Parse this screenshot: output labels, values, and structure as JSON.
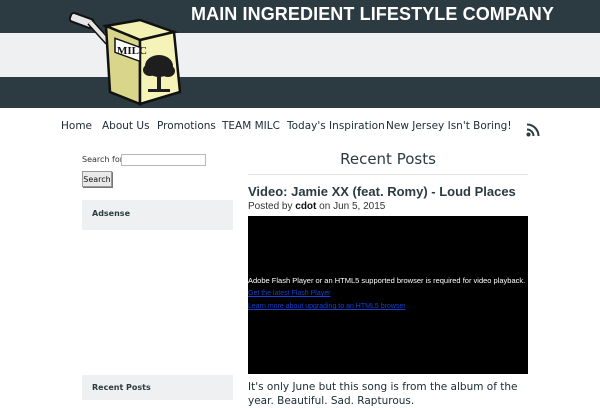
{
  "header": {
    "site_title": "MAIN INGREDIENT LIFESTYLE COMPANY",
    "logo_text": "MILC",
    "colors": {
      "dark_band": "#2b3b41",
      "light_band": "#eef0f2"
    }
  },
  "nav": {
    "items": [
      {
        "label": "Home"
      },
      {
        "label": "About Us"
      },
      {
        "label": "Promotions"
      },
      {
        "label": "TEAM MILC"
      },
      {
        "label": "Today's Inspiration"
      },
      {
        "label": "New Jersey Isn't Boring!"
      }
    ],
    "rss_icon": "rss-icon"
  },
  "sidebar": {
    "search": {
      "label": "Search for:",
      "value": "",
      "placeholder": "",
      "button_label": "Search"
    },
    "widgets": [
      {
        "title": "Adsense"
      },
      {
        "title": "Recent Posts"
      }
    ]
  },
  "main": {
    "section_title": "Recent Posts",
    "post": {
      "title": "Video: Jamie XX (feat. Romy) - Loud Places",
      "meta_prefix": "Posted by",
      "author": "cdot",
      "meta_mid": "on",
      "date": "Jun 5, 2015",
      "video": {
        "message": "Adobe Flash Player or an HTML5 supported browser is required for video playback.",
        "link1": "Get the latest Flash Player",
        "link2": "Learn more about upgrading to an HTML5 browser"
      },
      "excerpt": "It's only June but this song is from the album of the year. Beautiful. Sad. Rapturous."
    }
  }
}
